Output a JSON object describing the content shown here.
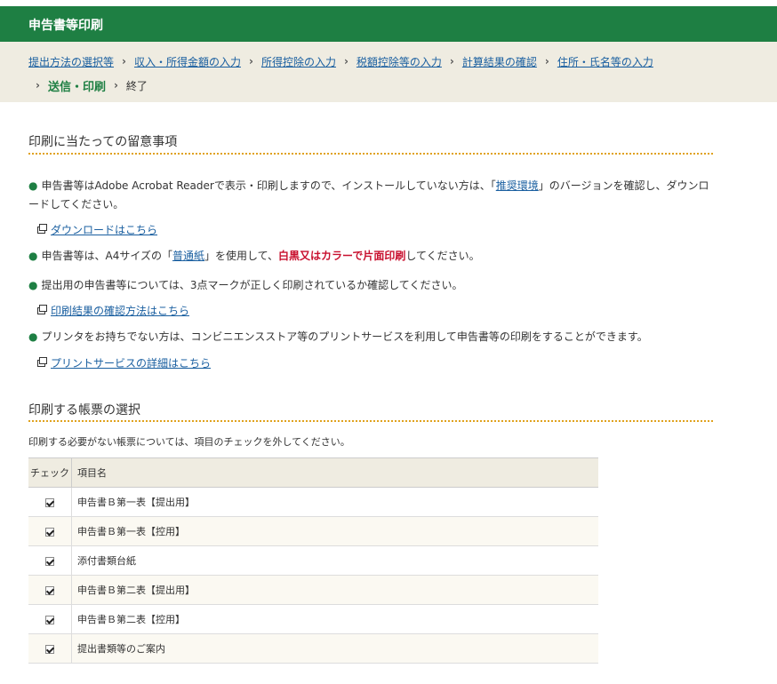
{
  "header": {
    "title": "申告書等印刷"
  },
  "breadcrumb": {
    "links": [
      "提出方法の選択等",
      "収入・所得金額の入力",
      "所得控除の入力",
      "税額控除等の入力",
      "計算結果の確認",
      "住所・氏名等の入力"
    ],
    "separator": "›",
    "current": "送信・印刷",
    "last": "終了"
  },
  "notes": {
    "title": "印刷に当たっての留意事項",
    "bullet_mark": "●",
    "item1": {
      "pre": "申告書等はAdobe Acrobat Readerで表示・印刷しますので、インストールしていない方は、「",
      "link": "推奨環境",
      "post": "」のバージョンを確認し、ダウンロードしてください。",
      "sublink": "ダウンロードはこちら"
    },
    "item2": {
      "pre": "申告書等は、A4サイズの「",
      "link": "普通紙",
      "mid": "」を使用して、",
      "emph": "白黒又はカラーで片面印刷",
      "post": "してください。"
    },
    "item3": {
      "text": "提出用の申告書等については、3点マークが正しく印刷されているか確認してください。",
      "sublink": "印刷結果の確認方法はこちら"
    },
    "item4": {
      "text": "プリンタをお持ちでない方は、コンビニエンスストア等のプリントサービスを利用して申告書等の印刷をすることができます。",
      "sublink": "プリントサービスの詳細はこちら"
    }
  },
  "selection": {
    "title": "印刷する帳票の選択",
    "description": "印刷する必要がない帳票については、項目のチェックを外してください。",
    "columns": [
      "チェック",
      "項目名"
    ],
    "rows": [
      {
        "checked": true,
        "name": "申告書Ｂ第一表【提出用】"
      },
      {
        "checked": true,
        "name": "申告書Ｂ第一表【控用】"
      },
      {
        "checked": true,
        "name": "添付書類台紙"
      },
      {
        "checked": true,
        "name": "申告書Ｂ第二表【提出用】"
      },
      {
        "checked": true,
        "name": "申告書Ｂ第二表【控用】"
      },
      {
        "checked": true,
        "name": "提出書類等のご案内"
      }
    ]
  },
  "colors": {
    "header_green": "#1e7f43",
    "link_blue": "#1a5fa0",
    "emphasis_red": "#c8102e",
    "dotted_orange": "#e0a21e"
  },
  "icons": {
    "external_link": "new-window-icon",
    "checkbox": "checkbox-checked-icon"
  }
}
